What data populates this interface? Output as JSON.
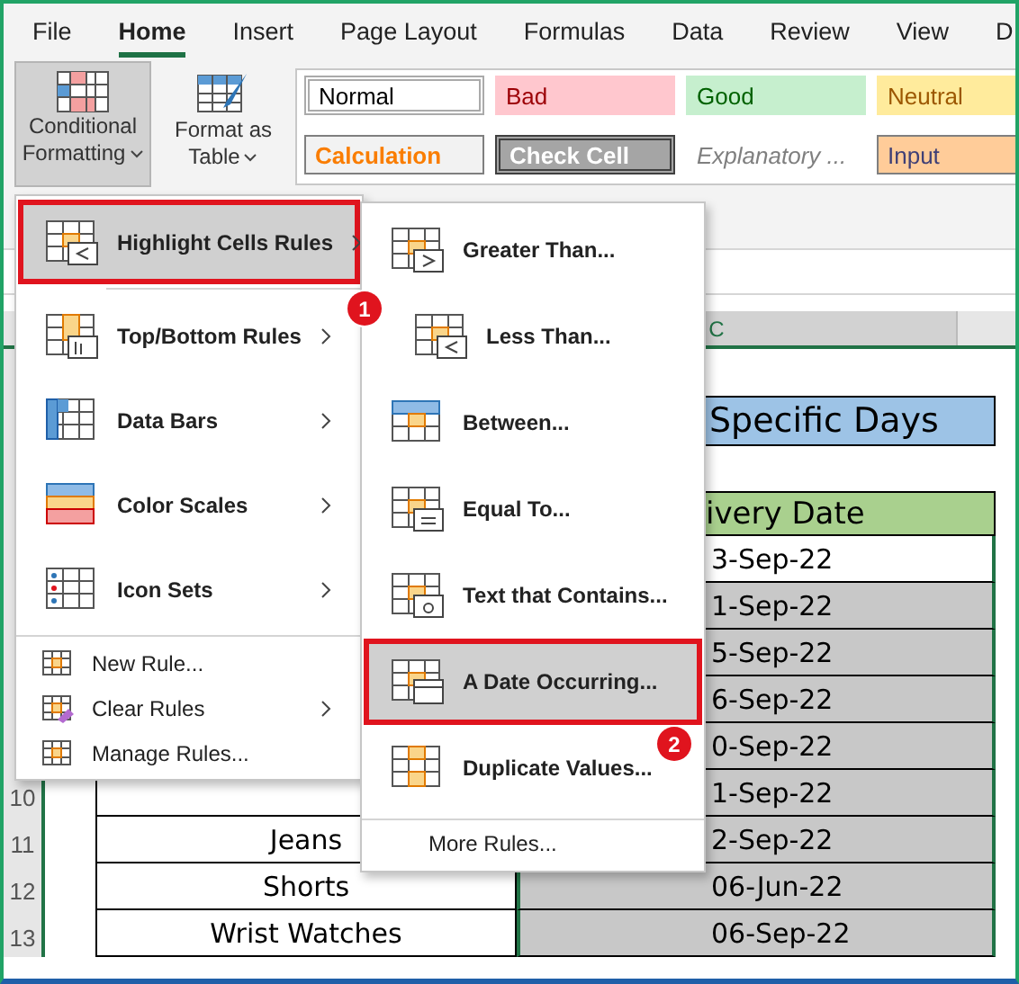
{
  "tabs": [
    {
      "label": "File",
      "selected": false
    },
    {
      "label": "Home",
      "selected": true
    },
    {
      "label": "Insert",
      "selected": false
    },
    {
      "label": "Page Layout",
      "selected": false
    },
    {
      "label": "Formulas",
      "selected": false
    },
    {
      "label": "Data",
      "selected": false
    },
    {
      "label": "Review",
      "selected": false
    },
    {
      "label": "View",
      "selected": false
    },
    {
      "label": "D",
      "selected": false
    }
  ],
  "ribbon_buttons": [
    {
      "lines": [
        "Conditional",
        "Formatting"
      ],
      "pressed": true
    },
    {
      "lines": [
        "Format as",
        "Table"
      ],
      "pressed": false
    }
  ],
  "cell_styles": [
    {
      "label": "Normal",
      "kind": "normal"
    },
    {
      "label": "Bad",
      "kind": "bad"
    },
    {
      "label": "Good",
      "kind": "good"
    },
    {
      "label": "Neutral",
      "kind": "neutral"
    },
    {
      "label": "Calculation",
      "kind": "calculation"
    },
    {
      "label": "Check Cell",
      "kind": "check"
    },
    {
      "label": "Explanatory ...",
      "kind": "explanatory"
    },
    {
      "label": "Input",
      "kind": "input"
    }
  ],
  "sheet": {
    "column_header": "C",
    "title": "Specific Days",
    "header": "ivery Date",
    "rows": [
      {
        "date": "3-Sep-22",
        "highlighted": false
      },
      {
        "date": "1-Sep-22",
        "highlighted": true
      },
      {
        "date": "5-Sep-22",
        "highlighted": true
      },
      {
        "date": "6-Sep-22",
        "highlighted": true
      },
      {
        "date": "0-Sep-22",
        "highlighted": true
      },
      {
        "row_number": "10",
        "date": "1-Sep-22",
        "highlighted": true
      },
      {
        "row_number": "11",
        "product": "Jeans",
        "date": "2-Sep-22",
        "highlighted": true
      },
      {
        "row_number": "12",
        "product": "Shorts",
        "date": "06-Jun-22",
        "highlighted": true
      },
      {
        "row_number": "13",
        "product": "Wrist Watches",
        "date": "06-Sep-22",
        "highlighted": true
      }
    ]
  },
  "menu": {
    "items": [
      {
        "label": "Highlight Cells Rules",
        "kind": "large",
        "submenu": true,
        "selected": true
      },
      {
        "label": "Top/Bottom Rules",
        "kind": "large",
        "submenu": true,
        "selected": false
      },
      {
        "label": "Data Bars",
        "kind": "large",
        "submenu": true,
        "selected": false
      },
      {
        "label": "Color Scales",
        "kind": "large",
        "submenu": true,
        "selected": false
      },
      {
        "label": "Icon Sets",
        "kind": "large",
        "submenu": true,
        "selected": false
      },
      {
        "label": "New Rule...",
        "kind": "small",
        "submenu": false,
        "selected": false
      },
      {
        "label": "Clear Rules",
        "kind": "small",
        "submenu": true,
        "selected": false
      },
      {
        "label": "Manage Rules...",
        "kind": "small",
        "submenu": false,
        "selected": false
      }
    ]
  },
  "submenu": {
    "items": [
      {
        "label": "Greater Than...",
        "selected": false
      },
      {
        "label": "Less Than...",
        "selected": false
      },
      {
        "label": "Between...",
        "selected": false
      },
      {
        "label": "Equal To...",
        "selected": false
      },
      {
        "label": "Text that Contains...",
        "selected": false
      },
      {
        "label": "A Date Occurring...",
        "selected": true
      },
      {
        "label": "Duplicate Values...",
        "selected": false
      }
    ],
    "more": "More Rules..."
  },
  "step_badges": [
    "1",
    "2"
  ]
}
